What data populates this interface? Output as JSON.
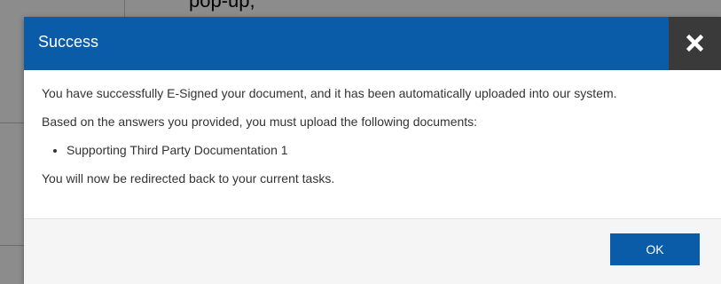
{
  "background": {
    "cutoff_text": "pop-up,"
  },
  "dialog": {
    "title": "Success",
    "close_icon": "close-icon",
    "messages": {
      "line1": "You have successfully E-Signed your document, and it has been automatically uploaded into our system.",
      "line2": "Based on the answers you provided, you must upload the following documents:",
      "documents": [
        "Supporting Third Party Documentation 1"
      ],
      "line3": "You will now be redirected back to your current tasks."
    },
    "ok_label": "OK"
  },
  "colors": {
    "header": "#0a5ca8",
    "close_bg": "#3a3a3a",
    "ok_button": "#0a5ca8",
    "backdrop": "#8c8c8c"
  }
}
